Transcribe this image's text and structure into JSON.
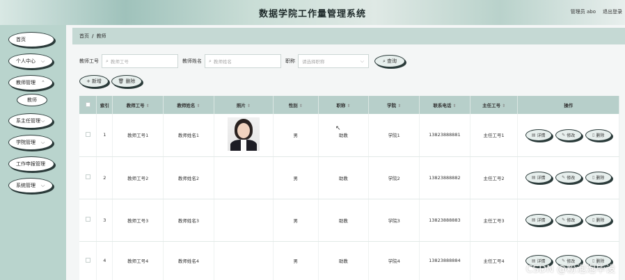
{
  "header": {
    "title": "数据学院工作量管理系统",
    "user": "管理员 abo",
    "logout": "退出登录"
  },
  "sidebar": {
    "items": [
      {
        "label": "首页",
        "has_chevron": false
      },
      {
        "label": "个人中心",
        "has_chevron": true
      },
      {
        "label": "教师管理",
        "has_chevron": true
      },
      {
        "label": "系主任管理",
        "has_chevron": true
      },
      {
        "label": "学院管理",
        "has_chevron": true
      },
      {
        "label": "工作申报管理",
        "has_chevron": false
      },
      {
        "label": "系统管理",
        "has_chevron": true
      }
    ],
    "submenu": {
      "label": "教师"
    }
  },
  "breadcrumb": {
    "home": "首页",
    "separator": "/",
    "current": "教师"
  },
  "search": {
    "teacher_id_label": "教师工号",
    "teacher_id_placeholder": "教师工号",
    "teacher_name_label": "教师姓名",
    "teacher_name_placeholder": "教师姓名",
    "title_label": "职称",
    "title_placeholder": "请选择职称",
    "query_button": "查询"
  },
  "actions": {
    "add": "新增",
    "delete": "删除"
  },
  "table": {
    "columns": [
      "索引",
      "教师工号",
      "教师姓名",
      "照片",
      "性别",
      "职称",
      "学院",
      "联系电话",
      "主任工号",
      "操作"
    ],
    "rows": [
      {
        "index": "1",
        "teacher_id": "教师工号1",
        "name": "教师姓名1",
        "has_photo": true,
        "gender": "男",
        "title": "助教",
        "college": "学院1",
        "phone": "13823888881",
        "director_id": "主任工号1"
      },
      {
        "index": "2",
        "teacher_id": "教师工号2",
        "name": "教师姓名2",
        "has_photo": false,
        "gender": "男",
        "title": "助教",
        "college": "学院2",
        "phone": "13823888882",
        "director_id": "主任工号2"
      },
      {
        "index": "3",
        "teacher_id": "教师工号3",
        "name": "教师姓名3",
        "has_photo": false,
        "gender": "男",
        "title": "助教",
        "college": "学院3",
        "phone": "13823888883",
        "director_id": "主任工号3"
      },
      {
        "index": "4",
        "teacher_id": "教师工号4",
        "name": "教师姓名4",
        "has_photo": false,
        "gender": "男",
        "title": "助教",
        "college": "学院4",
        "phone": "13823888884",
        "director_id": "主任工号4"
      }
    ],
    "row_actions": {
      "detail": "详情",
      "edit": "修改",
      "delete": "删除"
    }
  },
  "watermark": "CSDN @粉泡泡毕设",
  "colors": {
    "header_accent": "#9fc2bb",
    "sidebar_bg": "#b9d4cd",
    "table_header_bg": "#b7cfca",
    "button_border": "#2b3b3a"
  }
}
